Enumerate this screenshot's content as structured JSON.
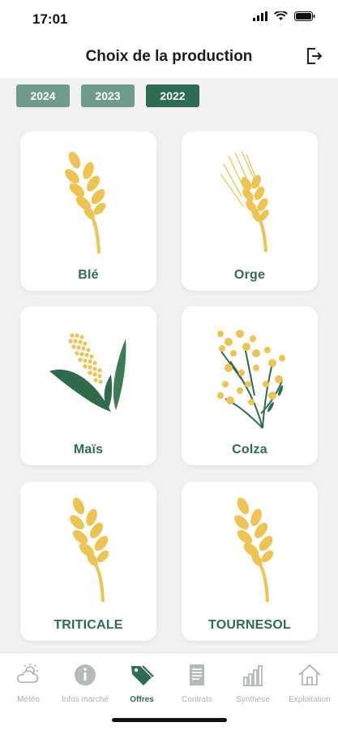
{
  "status_bar": {
    "time": "17:01"
  },
  "header": {
    "title": "Choix de la production"
  },
  "years": [
    {
      "label": "2024",
      "active": false
    },
    {
      "label": "2023",
      "active": false
    },
    {
      "label": "2022",
      "active": true
    }
  ],
  "productions": [
    {
      "label": "Blé",
      "icon": "wheat-icon"
    },
    {
      "label": "Orge",
      "icon": "barley-icon"
    },
    {
      "label": "Maïs",
      "icon": "corn-icon"
    },
    {
      "label": "Colza",
      "icon": "rapeseed-icon"
    },
    {
      "label": "TRITICALE",
      "icon": "wheat-icon"
    },
    {
      "label": "TOURNESOL",
      "icon": "wheat-icon"
    }
  ],
  "tabbar": {
    "items": [
      {
        "label": "Météo",
        "icon": "weather-icon",
        "active": false
      },
      {
        "label": "Infos marché",
        "icon": "info-icon",
        "active": false
      },
      {
        "label": "Offres",
        "icon": "tags-icon",
        "active": true
      },
      {
        "label": "Contrats",
        "icon": "document-icon",
        "active": false
      },
      {
        "label": "Synthèse",
        "icon": "bar-chart-icon",
        "active": false
      },
      {
        "label": "Exploitation",
        "icon": "home-icon",
        "active": false
      }
    ]
  },
  "colors": {
    "accent": "#2d6c53",
    "chip_inactive": "#6f9c8a",
    "grain_yellow": "#edc452",
    "leaf_green": "#2f6a4b",
    "background": "#f1f1f1"
  }
}
